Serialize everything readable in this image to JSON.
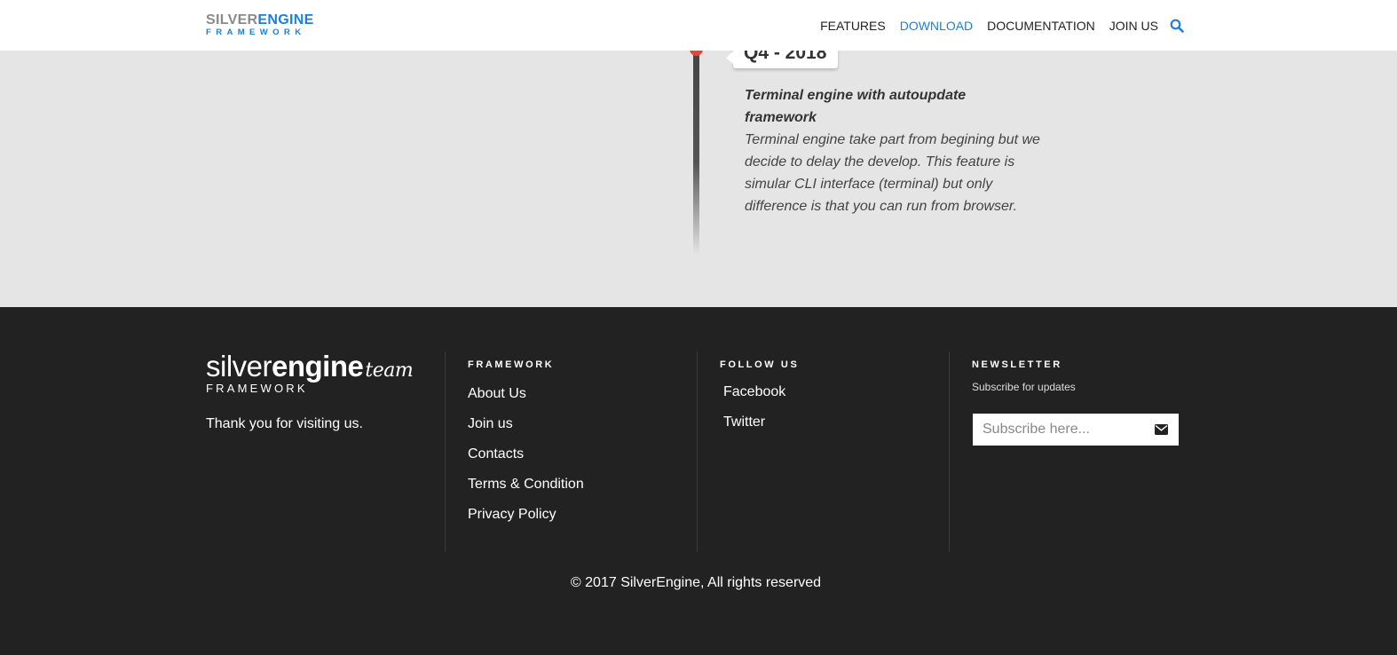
{
  "header": {
    "logo_silver": "SILVER",
    "logo_engine": "ENGINE",
    "logo_sub": "FRAMEWORK",
    "nav": [
      {
        "label": "FEATURES"
      },
      {
        "label": "DOWNLOAD"
      },
      {
        "label": "DOCUMENTATION"
      },
      {
        "label": "JOIN US"
      }
    ],
    "active_nav": "DOWNLOAD",
    "search_icon": "search-icon"
  },
  "timeline": {
    "date": "Q4 - 2018",
    "title": "Terminal engine with autoupdate framework",
    "text": "Terminal engine take part from begining but we decide to delay the develop. This feature is simular CLI interface (terminal) but only difference is that you can run from browser."
  },
  "footer": {
    "logo_silver": "silver",
    "logo_engine": "engine",
    "logo_team": "team",
    "logo_sub": "FRAMEWORK",
    "thanks": "Thank you for visiting us.",
    "framework_heading": "FRAMEWORK",
    "framework_links": [
      "About Us",
      "Join us",
      "Contacts",
      "Terms & Condition",
      "Privacy Policy"
    ],
    "follow_heading": "FOLLOW US",
    "follow_links": [
      "Facebook",
      "Twitter"
    ],
    "newsletter_heading": "NEWSLETTER",
    "newsletter_sub": "Subscribe for updates",
    "newsletter_placeholder": "Subscribe here...",
    "send_icon": "envelope-icon",
    "copyright": "© 2017 SilverEngine, All rights reserved"
  },
  "colors": {
    "accent": "#1d7fd8",
    "footer_bg": "#222222",
    "page_bg": "#e5e5e5",
    "timeline_dot": "#e04a3c"
  }
}
